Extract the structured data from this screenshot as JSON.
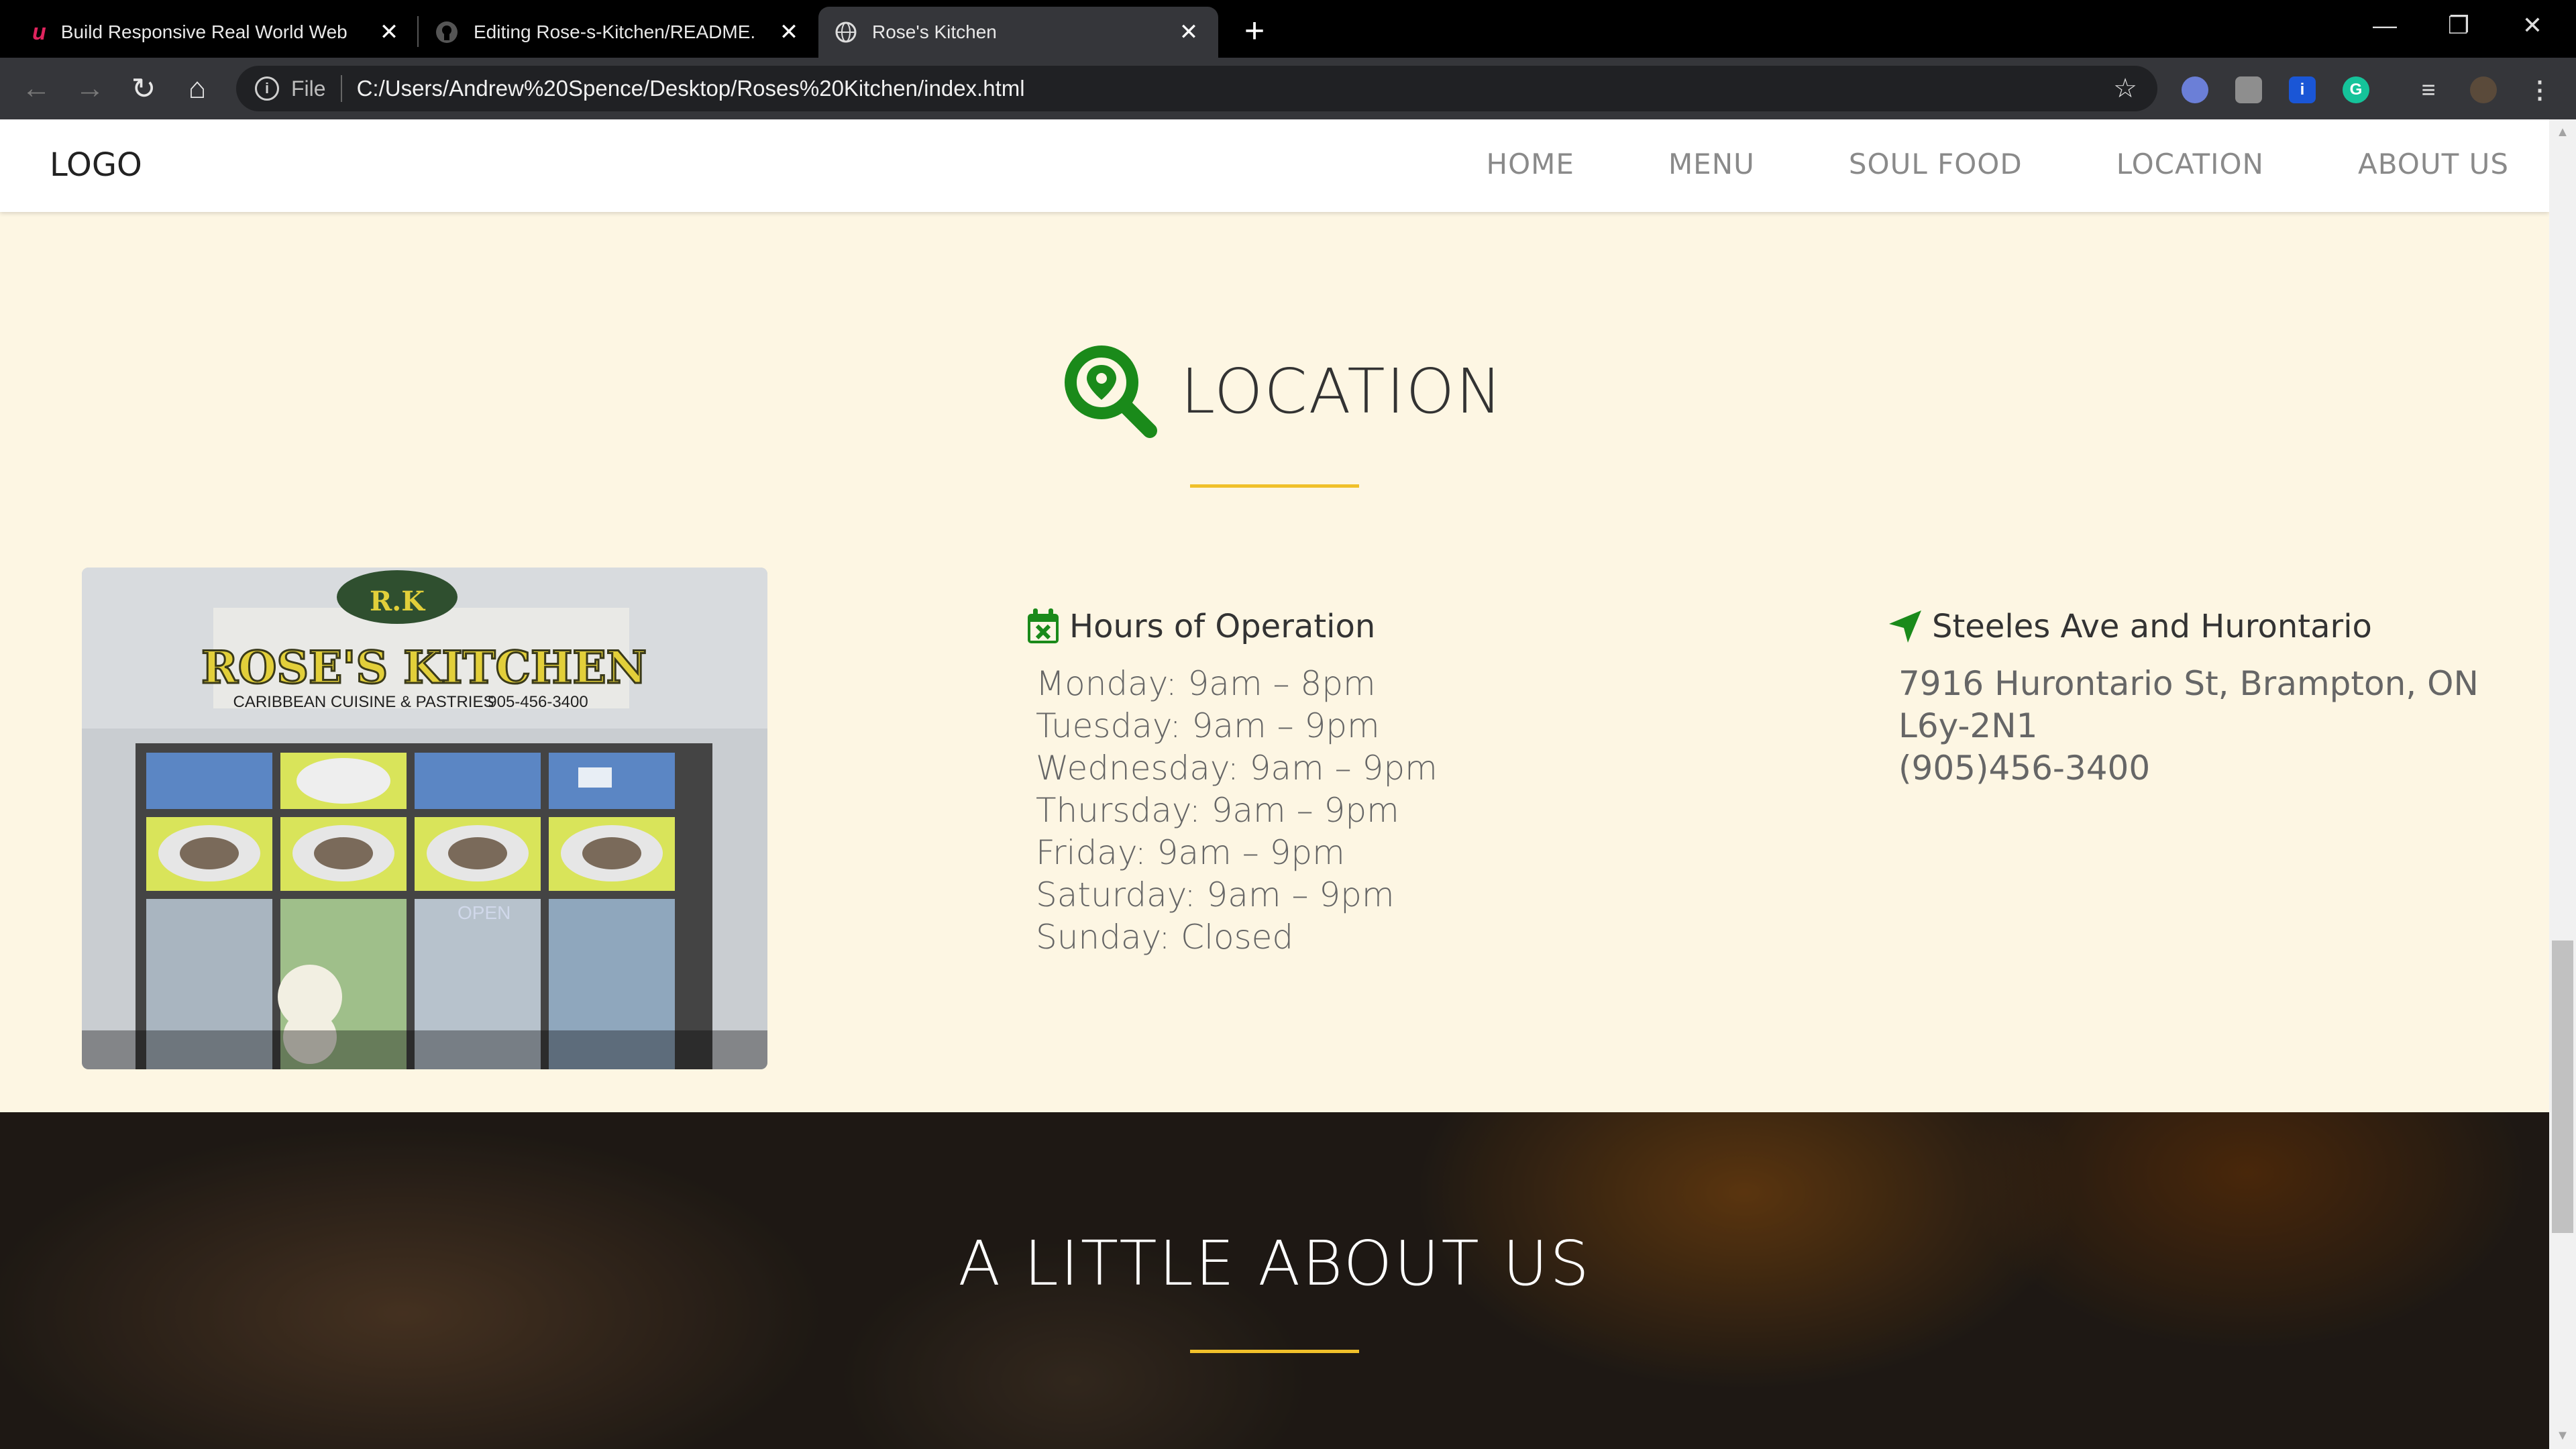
{
  "browser": {
    "tabs": [
      {
        "title": "Build Responsive Real World Web",
        "active": false,
        "icon": "udemy-icon"
      },
      {
        "title": "Editing Rose-s-Kitchen/README.",
        "active": false,
        "icon": "github-icon"
      },
      {
        "title": "Rose's Kitchen",
        "active": true,
        "icon": "globe-icon"
      }
    ],
    "address": {
      "scheme": "File",
      "url": "C:/Users/Andrew%20Spence/Desktop/Roses%20Kitchen/index.html"
    },
    "colors": {
      "chrome_dark": "#000000",
      "toolbar": "#35363a",
      "omnibox": "#202124"
    }
  },
  "site": {
    "logo": "LOGO",
    "nav": [
      "HOME",
      "MENU",
      "SOUL FOOD",
      "LOCATION",
      "ABOUT US"
    ],
    "location": {
      "title": "LOCATION",
      "photo": {
        "sign_name": "ROSE'S KITCHEN",
        "sign_tagline": "CARIBBEAN CUISINE & PASTRIES",
        "sign_phone": "905-456-3400",
        "monogram": "R.K",
        "door_text": "OPEN"
      },
      "hours_title": "Hours of Operation",
      "hours": [
        "Monday: 9am – 8pm",
        "Tuesday: 9am – 9pm",
        "Wednesday: 9am – 9pm",
        "Thursday: 9am – 9pm",
        "Friday: 9am – 9pm",
        "Saturday: 9am – 9pm",
        "Sunday: Closed"
      ],
      "address_title": "Steeles Ave and Hurontario",
      "address_line": "7916 Hurontario St, Brampton, ON L6y-2N1",
      "phone": "(905)456-3400"
    },
    "about": {
      "title": "A LITTLE ABOUT US"
    },
    "colors": {
      "background": "#fdf6e3",
      "accent_green": "#1a8a1a",
      "accent_gold": "#f0c02a"
    }
  }
}
